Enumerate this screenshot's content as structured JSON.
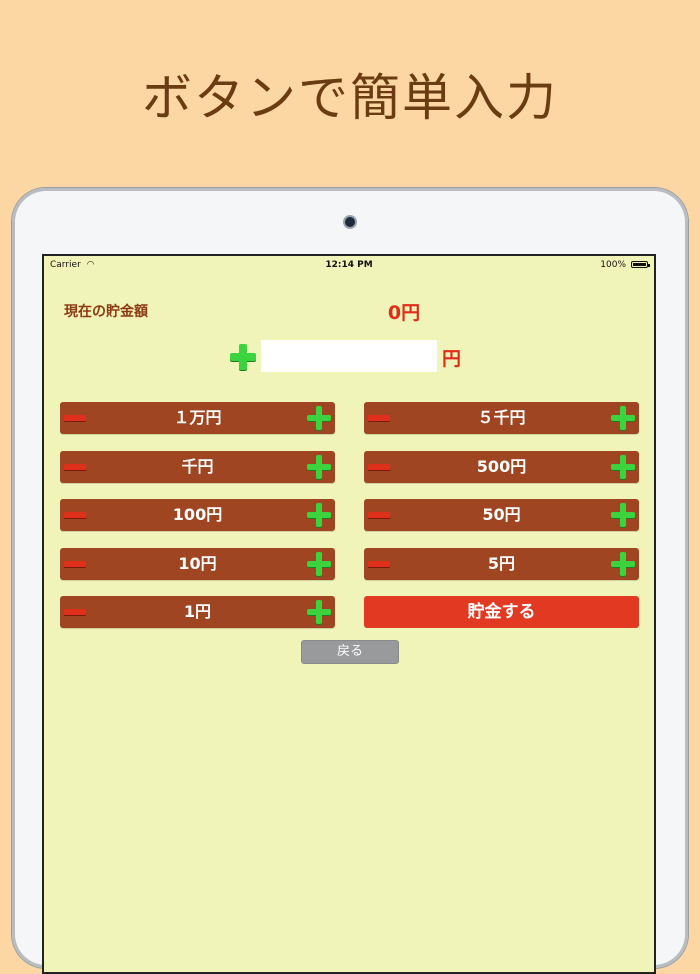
{
  "promo": {
    "headline": "ボタンで簡単入力"
  },
  "statusbar": {
    "carrier": "Carrier",
    "time": "12:14 PM",
    "battery": "100%"
  },
  "savings": {
    "label": "現在の貯金額",
    "value": "0円"
  },
  "custom_input": {
    "value": "",
    "placeholder": "",
    "suffix": "円"
  },
  "buttons": {
    "left": [
      {
        "label": "１万円"
      },
      {
        "label": "千円"
      },
      {
        "label": "100円"
      },
      {
        "label": "10円"
      },
      {
        "label": "1円"
      }
    ],
    "right": [
      {
        "label": "５千円"
      },
      {
        "label": "500円"
      },
      {
        "label": "50円"
      },
      {
        "label": "5円"
      }
    ]
  },
  "save_label": "貯金する",
  "back_label": "戻る",
  "colors": {
    "background": "#fcd6a3",
    "screen": "#f1f4b8",
    "button": "#a04521",
    "save_button": "#e23a22",
    "plus": "#3bd43f",
    "minus": "#e0301b",
    "accent_text": "#e02c19"
  },
  "icons": {
    "plus": "plus-icon",
    "minus": "minus-icon",
    "wifi": "wifi-icon",
    "battery": "battery-icon"
  }
}
